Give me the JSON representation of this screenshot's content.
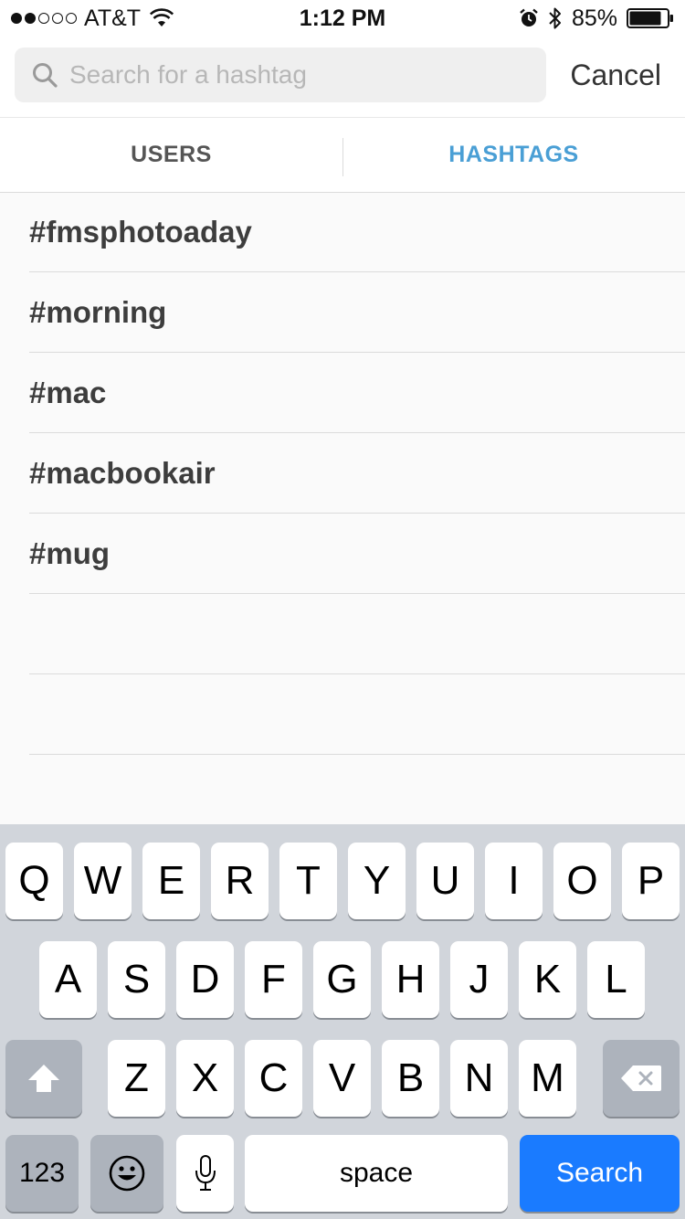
{
  "status_bar": {
    "carrier": "AT&T",
    "time": "1:12 PM",
    "battery_percent": "85%",
    "battery_level": 0.85,
    "signal_bars_filled": 2,
    "signal_bars_total": 5,
    "icons": [
      "wifi-icon",
      "alarm-icon",
      "bluetooth-icon",
      "battery-icon"
    ]
  },
  "search": {
    "placeholder": "Search for a hashtag",
    "value": "",
    "cancel_label": "Cancel"
  },
  "tabs": [
    {
      "label": "USERS",
      "active": false
    },
    {
      "label": "HASHTAGS",
      "active": true
    }
  ],
  "colors": {
    "active_tab": "#4a9fd5",
    "search_key": "#1a7bff"
  },
  "results": [
    {
      "label": "#fmsphotoaday"
    },
    {
      "label": "#morning"
    },
    {
      "label": "#mac"
    },
    {
      "label": "#macbookair"
    },
    {
      "label": "#mug"
    }
  ],
  "keyboard": {
    "row1": [
      "Q",
      "W",
      "E",
      "R",
      "T",
      "Y",
      "U",
      "I",
      "O",
      "P"
    ],
    "row2": [
      "A",
      "S",
      "D",
      "F",
      "G",
      "H",
      "J",
      "K",
      "L"
    ],
    "row3": [
      "Z",
      "X",
      "C",
      "V",
      "B",
      "N",
      "M"
    ],
    "numbers_label": "123",
    "space_label": "space",
    "search_label": "Search"
  }
}
